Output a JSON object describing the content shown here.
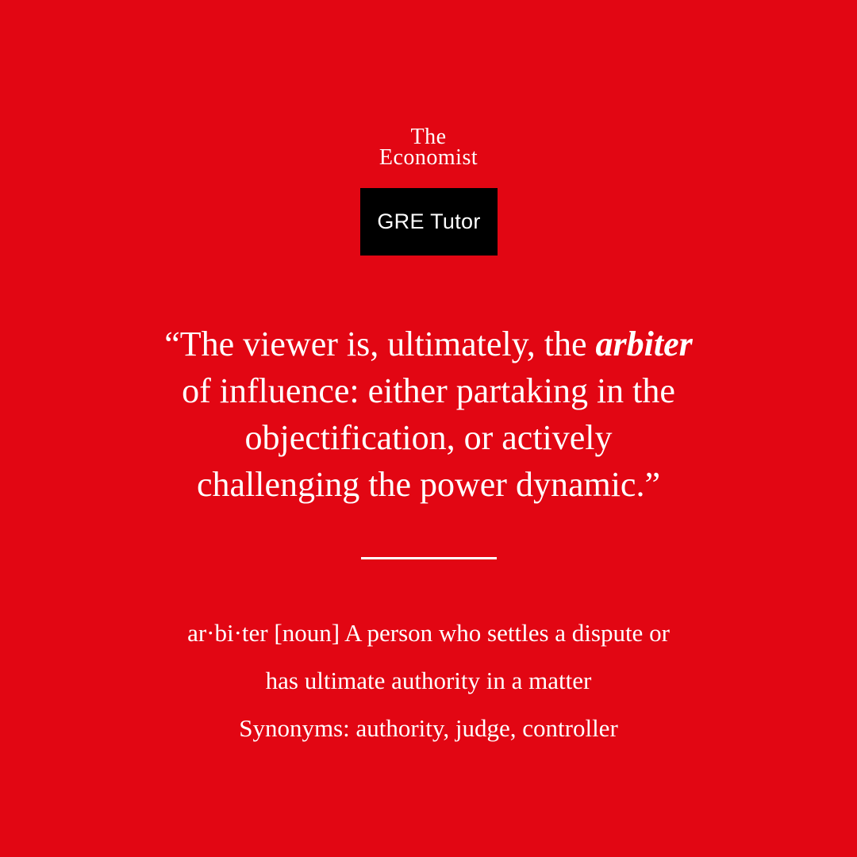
{
  "theme": {
    "background": "#e20613",
    "text": "#ffffff",
    "badge_background": "#000000"
  },
  "logo": {
    "line1": "The",
    "line2": "Economist"
  },
  "badge": {
    "label": "GRE Tutor"
  },
  "quote": {
    "line1_before": "“The viewer is, ultimately, the ",
    "keyword": "arbiter",
    "line2": "of influence: either partaking in the",
    "line3": "objectification, or actively",
    "line4": "challenging the power dynamic.”"
  },
  "definition": {
    "line1": "ar·bi·ter [noun] A person who settles a dispute or",
    "line2": "has ultimate authority in a matter",
    "synonyms": "Synonyms: authority, judge, controller"
  }
}
